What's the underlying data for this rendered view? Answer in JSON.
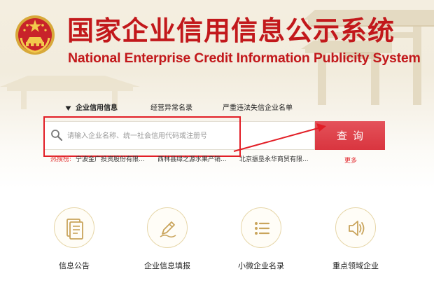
{
  "header": {
    "title_cn": "国家企业信用信息公示系统",
    "title_en": "National Enterprise Credit Information Publicity System",
    "emblem_icon": "national-emblem-icon"
  },
  "tabs": [
    {
      "label": "企业信用信息",
      "active": true
    },
    {
      "label": "经营异常名录",
      "active": false
    },
    {
      "label": "严重违法失信企业名单",
      "active": false
    }
  ],
  "search": {
    "placeholder": "请输入企业名称、统一社会信用代码或注册号",
    "value": "",
    "button_label": "查询",
    "icon": "search-icon"
  },
  "hot_search": {
    "label": "热搜榜:",
    "items": [
      "宁波金广投资股份有限...",
      "西林县绿之源水果产销...",
      "北京振垦永华商贸有限..."
    ],
    "more_label": "更多"
  },
  "services": [
    {
      "label": "信息公告",
      "icon": "notice-document-icon"
    },
    {
      "label": "企业信息填报",
      "icon": "fill-report-pen-icon"
    },
    {
      "label": "小微企业名录",
      "icon": "list-directory-icon"
    },
    {
      "label": "重点领域企业",
      "icon": "broadcast-speaker-icon"
    }
  ],
  "colors": {
    "brand_red": "#c2181b",
    "button_red": "#d9353f",
    "annotation_red": "#e21e26",
    "icon_gold": "#c9a45b"
  }
}
